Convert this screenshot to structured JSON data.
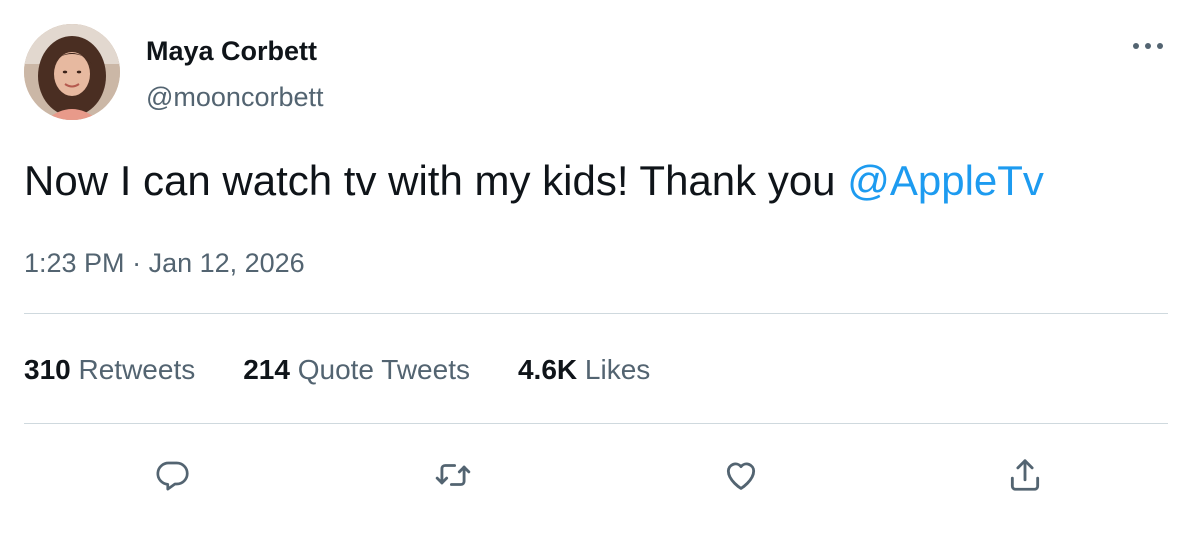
{
  "author": {
    "name": "Maya Corbett",
    "handle": "@mooncorbett"
  },
  "tweet": {
    "text_before_mention": "Now I can watch tv with my kids! Thank you ",
    "mention": "@AppleTv",
    "time": "1:23 PM",
    "separator": " · ",
    "date": "Jan 12, 2026"
  },
  "stats": {
    "retweets": {
      "count": "310",
      "label": "Retweets"
    },
    "quote_tweets": {
      "count": "214",
      "label": "Quote Tweets"
    },
    "likes": {
      "count": "4.6K",
      "label": "Likes"
    }
  },
  "icons": {
    "more": "more-options-icon",
    "reply": "reply-icon",
    "retweet": "retweet-icon",
    "like": "heart-icon",
    "share": "share-icon"
  },
  "colors": {
    "text": "#0f1419",
    "secondary": "#536471",
    "accent": "#1d9bf0",
    "divider": "#cfd9de"
  }
}
